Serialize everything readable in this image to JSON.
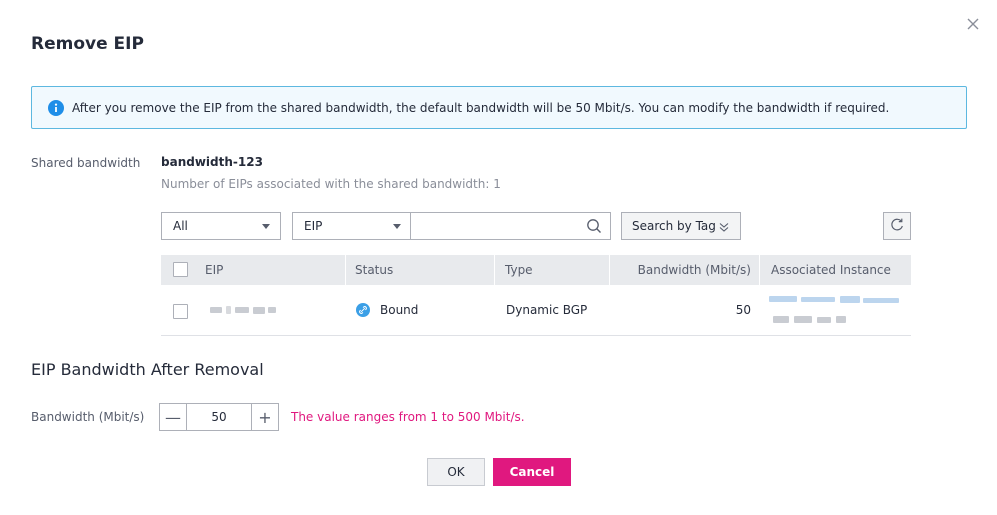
{
  "dialog": {
    "title": "Remove EIP"
  },
  "info": {
    "message": "After you remove the EIP from the shared bandwidth, the default bandwidth will be 50 Mbit/s. You can modify the bandwidth if required."
  },
  "shared_bandwidth": {
    "label": "Shared bandwidth",
    "name": "bandwidth-123",
    "count_text": "Number of EIPs associated with the shared bandwidth: 1"
  },
  "filters": {
    "scope_select": "All",
    "field_select": "EIP",
    "search_value": "",
    "tag_button": "Search by Tag"
  },
  "table": {
    "columns": [
      "EIP",
      "Status",
      "Type",
      "Bandwidth (Mbit/s)",
      "Associated Instance"
    ],
    "rows": [
      {
        "eip": "",
        "status": "Bound",
        "type": "Dynamic BGP",
        "bandwidth": "50",
        "instance": ""
      }
    ]
  },
  "after_removal": {
    "section_title": "EIP Bandwidth After Removal",
    "bandwidth_label": "Bandwidth (Mbit/s)",
    "bandwidth_value": "50",
    "minus_label": "—",
    "plus_label": "+",
    "range_hint": "The value ranges from 1 to 500 Mbit/s."
  },
  "footer": {
    "ok_label": "OK",
    "cancel_label": "Cancel"
  },
  "colors": {
    "accent": "#e0187f",
    "info_border": "#5db8e0",
    "info_icon": "#1f8ee8",
    "bound_icon": "#3b9fe6"
  }
}
